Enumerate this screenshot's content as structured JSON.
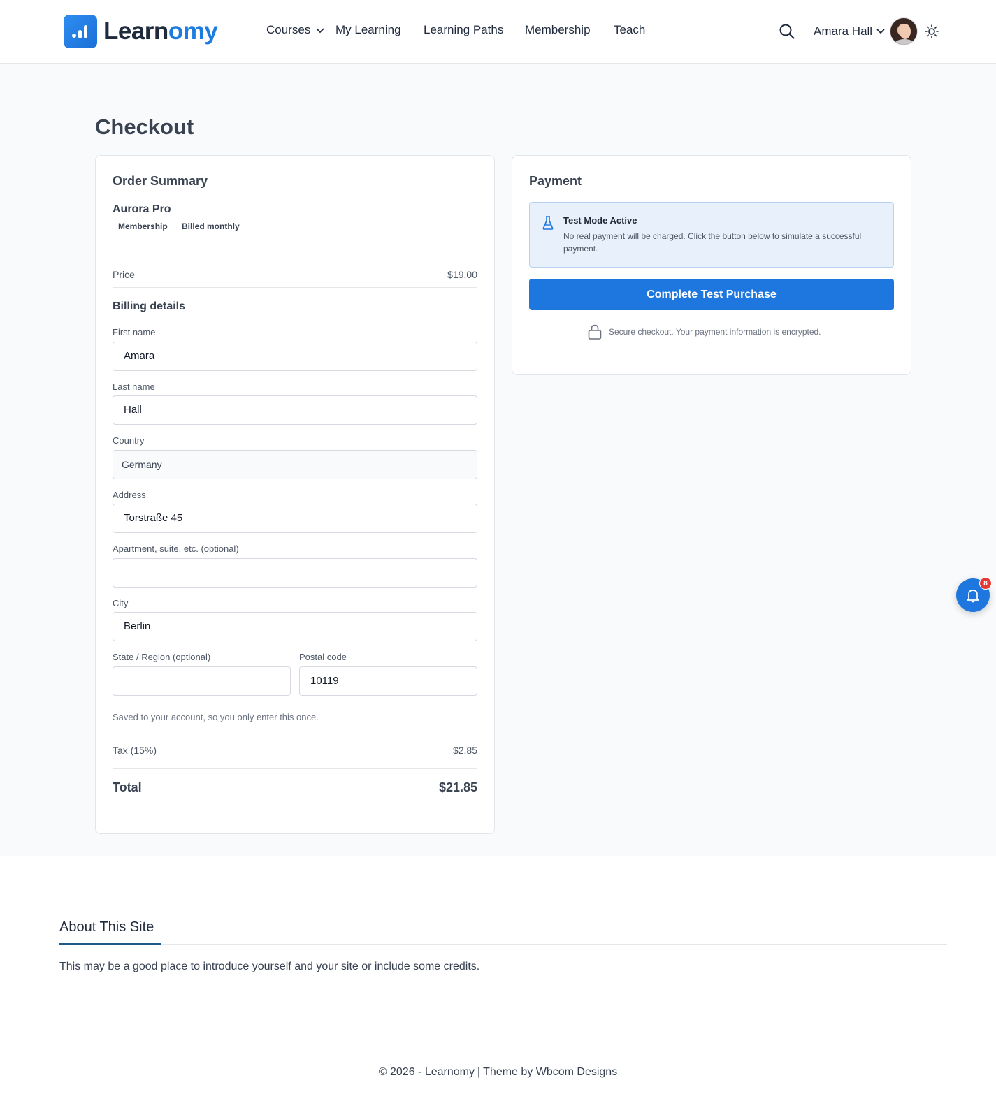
{
  "brand": {
    "name_part1": "Learn",
    "name_part2": "omy",
    "accent": "#1e77de"
  },
  "nav": {
    "items": [
      {
        "label": "Courses"
      },
      {
        "label": "My Learning"
      },
      {
        "label": "Learning Paths"
      },
      {
        "label": "Membership"
      },
      {
        "label": "Teach"
      }
    ]
  },
  "user": {
    "name": "Amara Hall"
  },
  "page": {
    "title": "Checkout"
  },
  "order": {
    "heading": "Order Summary",
    "product": "Aurora Pro",
    "tags": [
      "Membership",
      "Billed monthly"
    ],
    "price_label": "Price",
    "price_value": "$19.00",
    "tax_label": "Tax (15%)",
    "tax_value": "$2.85",
    "total_label": "Total",
    "total_value": "$21.85"
  },
  "billing": {
    "heading": "Billing details",
    "first_name_label": "First name",
    "first_name_value": "Amara",
    "last_name_label": "Last name",
    "last_name_value": "Hall",
    "country_label": "Country",
    "country_value": "Germany",
    "address_label": "Address",
    "address_value": "Torstraße 45",
    "apartment_label": "Apartment, suite, etc. (optional)",
    "apartment_value": "",
    "city_label": "City",
    "city_value": "Berlin",
    "state_label": "State / Region (optional)",
    "state_value": "",
    "postal_label": "Postal code",
    "postal_value": "10119",
    "hint": "Saved to your account, so you only enter this once."
  },
  "payment": {
    "heading": "Payment",
    "notice_title": "Test Mode Active",
    "notice_body": "No real payment will be charged. Click the button below to simulate a successful payment.",
    "button_label": "Complete Test Purchase",
    "secure_text": "Secure checkout. Your payment information is encrypted."
  },
  "notifications": {
    "count": "8"
  },
  "about": {
    "title": "About This Site",
    "text": "This may be a good place to introduce yourself and your site or include some credits."
  },
  "footer": {
    "copyright": "© 2026 - Learnomy",
    "theme": "Theme by Wbcom Designs"
  }
}
